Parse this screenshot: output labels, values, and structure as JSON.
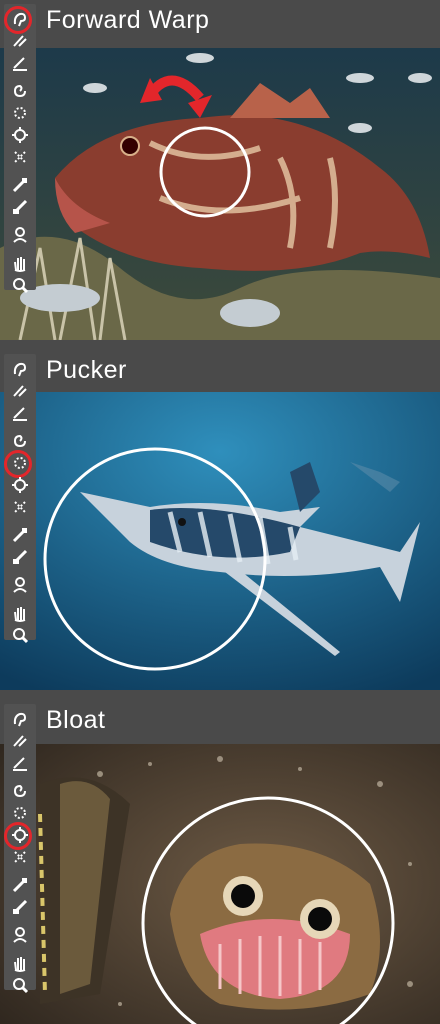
{
  "panels": [
    {
      "title": "Forward Warp",
      "selected_tool": "forward-warp"
    },
    {
      "title": "Pucker",
      "selected_tool": "pucker"
    },
    {
      "title": "Bloat",
      "selected_tool": "bloat"
    }
  ],
  "tools": [
    "forward-warp-icon",
    "reconstruct-icon",
    "smooth-icon",
    "twirl-icon",
    "pucker-icon",
    "bloat-icon",
    "push-left-icon",
    "freeze-mask-icon",
    "thaw-mask-icon",
    "face-icon",
    "hand-icon",
    "zoom-icon"
  ],
  "colors": {
    "highlight": "#e3262b",
    "arrow": "#e3262b",
    "ring": "#ffffff"
  }
}
